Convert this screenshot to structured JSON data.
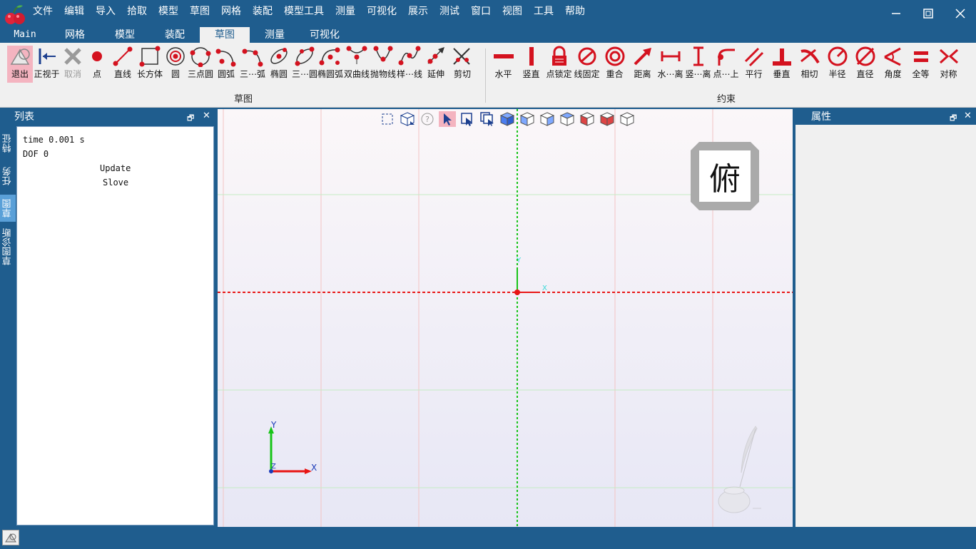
{
  "menubar": {
    "items": [
      "文件",
      "编辑",
      "导入",
      "拾取",
      "模型",
      "草图",
      "网格",
      "装配",
      "模型工具",
      "测量",
      "可视化",
      "展示",
      "测试",
      "窗口",
      "视图",
      "工具",
      "帮助"
    ]
  },
  "ribbon_tabs": [
    "Main",
    "网格",
    "模型",
    "装配",
    "草图",
    "测量",
    "可视化"
  ],
  "active_ribbon_tab": "草图",
  "sketch_tools": [
    {
      "label": "退出",
      "icon": "exit-sketch-icon",
      "state": "selected"
    },
    {
      "label": "正视于",
      "icon": "normal-to-icon",
      "state": "normal"
    },
    {
      "label": "取消",
      "icon": "cancel-x-icon",
      "state": "disabled"
    },
    {
      "label": "点",
      "icon": "point-icon",
      "state": "normal"
    },
    {
      "label": "直线",
      "icon": "line-icon",
      "state": "normal"
    },
    {
      "label": "长方体",
      "icon": "rectangle-icon",
      "state": "normal"
    },
    {
      "label": "圆",
      "icon": "circle-icon",
      "state": "normal"
    },
    {
      "label": "三点圆",
      "icon": "three-point-circle-icon",
      "state": "normal"
    },
    {
      "label": "圆弧",
      "icon": "arc-icon",
      "state": "normal"
    },
    {
      "label": "三⋯弧",
      "icon": "three-point-arc-icon",
      "state": "normal"
    },
    {
      "label": "椭圆",
      "icon": "ellipse-icon",
      "state": "normal"
    },
    {
      "label": "三⋯圆",
      "icon": "three-point-ellipse-icon",
      "state": "normal"
    },
    {
      "label": "椭圆弧",
      "icon": "elliptic-arc-icon",
      "state": "normal"
    },
    {
      "label": "双曲线",
      "icon": "hyperbola-icon",
      "state": "normal"
    },
    {
      "label": "抛物线",
      "icon": "parabola-icon",
      "state": "normal"
    },
    {
      "label": "样⋯线",
      "icon": "spline-icon",
      "state": "normal"
    },
    {
      "label": "延伸",
      "icon": "extend-icon",
      "state": "normal"
    },
    {
      "label": "剪切",
      "icon": "trim-icon",
      "state": "normal"
    }
  ],
  "sketch_group_label": "草图",
  "constraint_tools": [
    {
      "label": "水平",
      "icon": "horizontal-icon"
    },
    {
      "label": "竖直",
      "icon": "vertical-icon"
    },
    {
      "label": "点锁定",
      "icon": "lock-icon"
    },
    {
      "label": "线固定",
      "icon": "fix-line-icon"
    },
    {
      "label": "重合",
      "icon": "coincident-icon"
    },
    {
      "label": "距离",
      "icon": "distance-icon"
    },
    {
      "label": "水⋯离",
      "icon": "horizontal-distance-icon"
    },
    {
      "label": "竖⋯离",
      "icon": "vertical-distance-icon"
    },
    {
      "label": "点⋯上",
      "icon": "point-on-object-icon"
    },
    {
      "label": "平行",
      "icon": "parallel-icon"
    },
    {
      "label": "垂直",
      "icon": "perpendicular-icon"
    },
    {
      "label": "相切",
      "icon": "tangent-icon"
    },
    {
      "label": "半径",
      "icon": "radius-icon"
    },
    {
      "label": "直径",
      "icon": "diameter-icon"
    },
    {
      "label": "角度",
      "icon": "angle-icon"
    },
    {
      "label": "全等",
      "icon": "equal-icon"
    },
    {
      "label": "对称",
      "icon": "symmetric-icon"
    }
  ],
  "constraint_group_label": "约束",
  "left_panel": {
    "title": "列表",
    "vertical_tabs": [
      "特征",
      "任务",
      "草图",
      "草图诊断"
    ],
    "active_vtab": "草图",
    "lines": [
      "time 0.001 s",
      "DOF 0"
    ],
    "update_label": "Update",
    "solve_label": "Slove"
  },
  "right_panel": {
    "title": "属性"
  },
  "viewport": {
    "view_cube_label": "俯",
    "axis_x": "X",
    "axis_y": "Y",
    "axis_z": "Z",
    "toolbar_icons": [
      "fit-all-icon",
      "view-orientation-icon",
      "help-icon",
      "select-arrow-icon",
      "box-select-icon",
      "window-select-icon",
      "view-iso-icon",
      "view-front-icon",
      "view-right-icon",
      "view-top-icon",
      "view-shaded-icon",
      "view-hidden-line-icon",
      "view-wireframe-icon"
    ]
  }
}
